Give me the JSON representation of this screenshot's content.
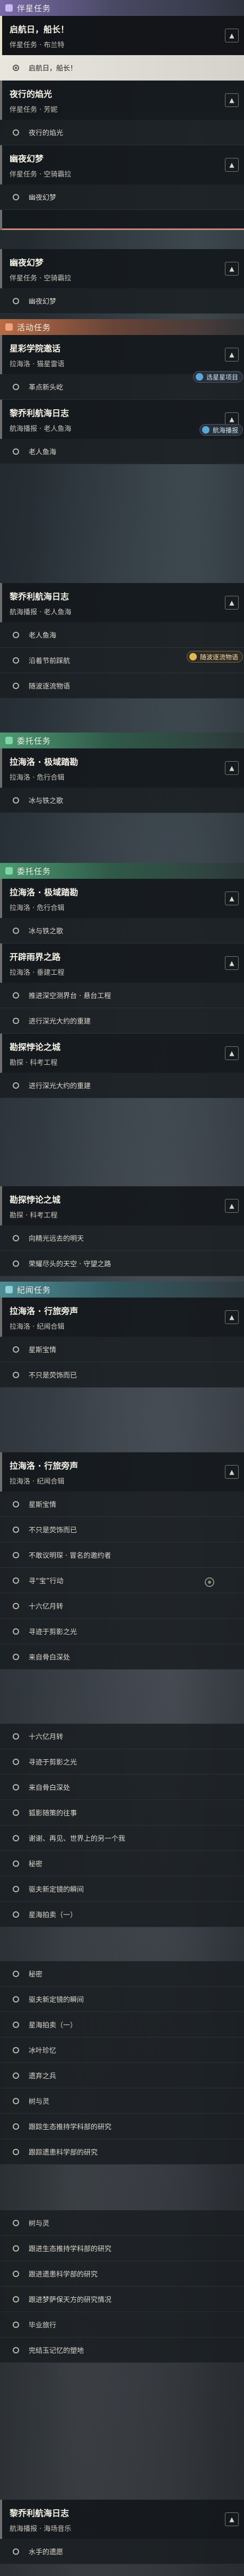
{
  "categories": {
    "partner": "伴星任务",
    "event": "活动任务",
    "daily": "委托任务",
    "daily2": "委托任务",
    "record": "纪闻任务"
  },
  "tags": {
    "star": "选星星项目",
    "sea_daily": "航海播报",
    "sea_daily2": "航海播报",
    "follow": "随波逐流物语"
  },
  "missions": {
    "m1": {
      "title": "启航日，船长！",
      "sub": "伴星任务 · 布兰特"
    },
    "m2": {
      "title": "夜行的焰光",
      "sub": "伴星任务 · 芳妮"
    },
    "m3": {
      "title": "幽夜幻梦",
      "sub": "伴星任务 · 空骑霸拉"
    },
    "m4": {
      "title": "幽夜幻梦",
      "sub": "伴星任务 · 空骑霸拉"
    },
    "m5": {
      "title": "星彩学院邀话",
      "sub": "拉海洛 · 猫星雷语"
    },
    "m6": {
      "title": "黎乔利航海日志",
      "sub": "航海播报 · 老人鱼海"
    },
    "m7": {
      "title": "黎乔利航海日志",
      "sub": "航海播报 · 老人鱼海"
    },
    "m8": {
      "title": "拉海洛 · 极域踏勘",
      "sub": "拉海洛 · 危行合辑"
    },
    "m9": {
      "title": "拉海洛 · 极域踏勘",
      "sub": "拉海洛 · 危行合辑"
    },
    "m10": {
      "title": "开辟雨界之路",
      "sub": "拉海洛 · 垂建工程"
    },
    "m11": {
      "title": "勘探悖论之城",
      "sub": "勘探 · 科考工程"
    },
    "m12": {
      "title": "勘探悖论之城",
      "sub": "勘探 · 科考工程"
    },
    "m13": {
      "title": "拉海洛 · 行旅旁声",
      "sub": "拉海洛 · 纪闻合辑"
    },
    "m14": {
      "title": "拉海洛 · 行旅旁声",
      "sub": "拉海洛 · 纪闻合辑"
    },
    "m15": {
      "title": "黎乔利航海日志",
      "sub": "航海播报 · 海场音乐"
    }
  },
  "steps": {
    "s1": "启航日，船长！",
    "s2": "夜行的焰光",
    "s3": "幽夜幻梦",
    "s4": "幽夜幻梦",
    "s5": "革点新头屹",
    "s6": "老人鱼海",
    "s7": "老人鱼海",
    "s8": "沿着节前踩航",
    "s9": "随波逐流物语",
    "s10": "冰与铁之歌",
    "s11": "冰与铁之歌",
    "s12": "推进深空测界台 · 悬台工程",
    "s13": "进行深光大约的重建",
    "s14": "进行深光大约的重建",
    "s15": "向精光远去的明天",
    "s16": "荣耀尽头的天空 · 守望之路",
    "s17": "星斯宝情",
    "s18": "星斯宝情",
    "s19": "星斯宝情",
    "s20": "不只是荧饰而已",
    "s21": "不敢议明琛 · 冒名的邀约者",
    "s22": "寻“宝”行动",
    "s23": "十六亿月转",
    "s24": "寻迹于剪影之光",
    "s25": "来自骨白深处",
    "s26": "十六亿月转",
    "s27": "寻迹于剪影之光",
    "s28": "来自骨白深处",
    "s29": "狐影随策的往事",
    "s30": "谢谢、再见、世界上的另一个我",
    "s31": "秘密",
    "s32": "驱夫新定镜的瞬间",
    "s33": "星海拍卖（一）",
    "s34": "秘密",
    "s35": "驱夫新定镜的瞬间",
    "s36": "星海拍卖（一）",
    "s37": "冰叶珍忆",
    "s38": "遗弃之兵",
    "s39": "树与灵",
    "s40": "跟踪生态推持学科部的研究",
    "s41": "跟踪遗患科学部的研究",
    "s42": "树与灵",
    "s43": "跟进生态推持学科部的研究",
    "s44": "跟进遗患科学部的研究",
    "s45": "跟进梦萨保天方的研究情况",
    "s46": "毕业旅行",
    "s47": "完结玉记忆的塑地",
    "s48": "水手的遗愿"
  }
}
